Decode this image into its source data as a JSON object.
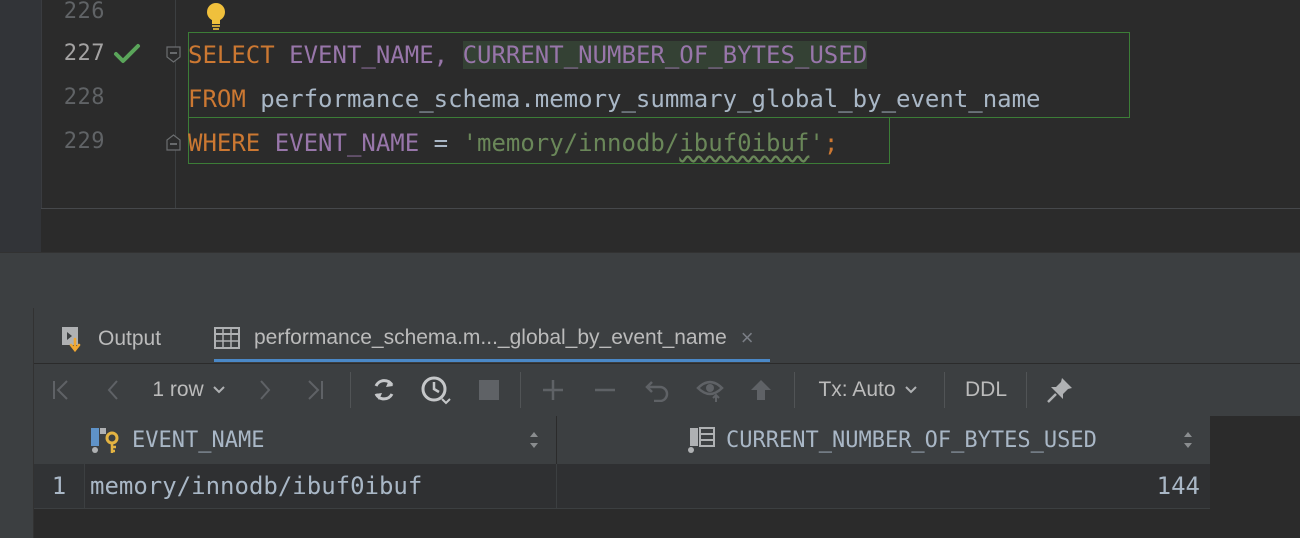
{
  "editor": {
    "line_numbers": [
      "226",
      "227",
      "228",
      "229"
    ],
    "code": {
      "line227": {
        "kw": "SELECT",
        "col1": "EVENT_NAME",
        "comma": ",",
        "col2": "CURRENT_NUMBER_OF_BYTES_USED"
      },
      "line228": {
        "kw": "FROM",
        "table": "performance_schema.memory_summary_global_by_event_name"
      },
      "line229": {
        "kw": "WHERE",
        "col": "EVENT_NAME",
        "op": "=",
        "str_prefix": "'memory/innodb/",
        "str_squig": "ibuf0ibuf",
        "str_suffix": "'",
        "semi": ";"
      }
    },
    "colors": {
      "keyword": "#cc7832",
      "column": "#9876aa",
      "string": "#6a8759",
      "text": "#a9b7c6",
      "statement_border": "#3c7d37"
    }
  },
  "tool_window": {
    "tabs": [
      {
        "label": "Output",
        "icon": "output-icon"
      },
      {
        "label": "performance_schema.m..._global_by_event_name",
        "icon": "table-icon",
        "close": "×",
        "active": true
      }
    ],
    "toolbar": {
      "row_count": "1 row",
      "tx_mode": "Tx: Auto",
      "ddl": "DDL"
    },
    "grid": {
      "columns": [
        {
          "name": "EVENT_NAME",
          "icon": "primary-key-column-icon"
        },
        {
          "name": "CURRENT_NUMBER_OF_BYTES_USED",
          "icon": "column-icon"
        }
      ],
      "rows": [
        {
          "num": "1",
          "cells": [
            "memory/innodb/ibuf0ibuf",
            "144"
          ]
        }
      ]
    }
  }
}
